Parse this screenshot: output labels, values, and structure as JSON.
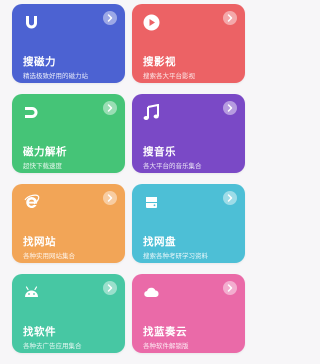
{
  "cards": [
    {
      "title": "搜磁力",
      "subtitle": "精选极致好用的磁力站",
      "icon": "magnet-u-icon",
      "color": "#4c62d2"
    },
    {
      "title": "搜影视",
      "subtitle": "搜索各大平台影视",
      "icon": "play-icon",
      "color": "#ec6265"
    },
    {
      "title": "磁力解析",
      "subtitle": "超快下载速度",
      "icon": "magnet-icon",
      "color": "#45c477"
    },
    {
      "title": "搜音乐",
      "subtitle": "各大平台的音乐集合",
      "icon": "music-note-icon",
      "color": "#7a49c6"
    },
    {
      "title": "找网站",
      "subtitle": "各种实用网站集合",
      "icon": "browser-e-icon",
      "color": "#f2a557"
    },
    {
      "title": "找网盘",
      "subtitle": "搜索各种考研学习资料",
      "icon": "hard-drive-icon",
      "color": "#4dbfd6"
    },
    {
      "title": "找软件",
      "subtitle": "各种去广告应用集合",
      "icon": "android-icon",
      "color": "#47c7a3"
    },
    {
      "title": "找蓝奏云",
      "subtitle": "各种软件解锁版",
      "icon": "cloud-icon",
      "color": "#ea6aa8"
    }
  ]
}
